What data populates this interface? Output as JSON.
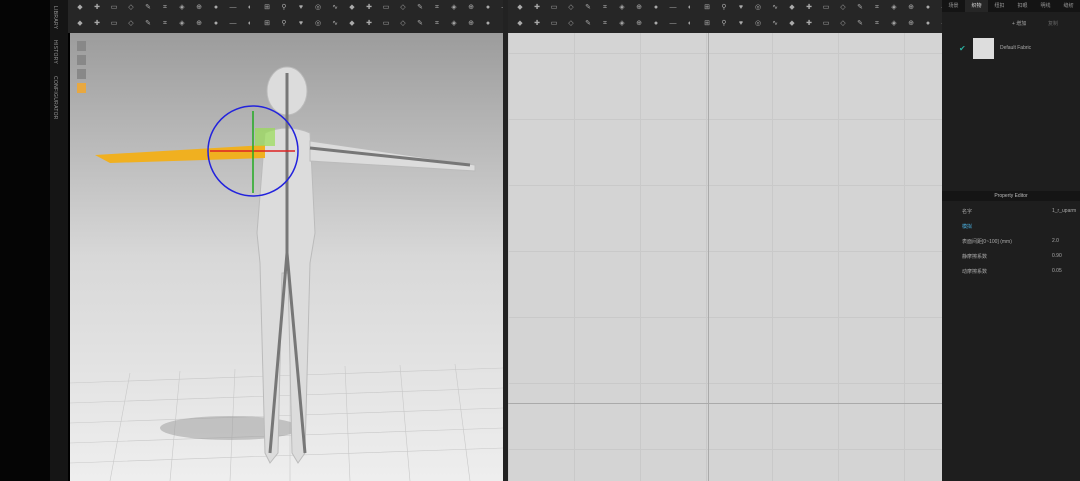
{
  "sidebar": {
    "tabs": [
      "LIBRARY",
      "HISTORY",
      "CONFIGURATOR"
    ]
  },
  "right_panel": {
    "tabs": [
      "场景",
      "织物",
      "纽扣",
      "扣眼",
      "明线",
      "缝纫"
    ],
    "active_tab": 1,
    "add_label": "+ 增加",
    "copy_label": "复制",
    "fabric": {
      "name": "Default Fabric",
      "checked": true
    },
    "property_editor": {
      "title": "Property Editor",
      "rows": [
        {
          "label": "名字",
          "value": "1_r_uparm"
        },
        {
          "label": "模拟",
          "value": "",
          "section": true
        },
        {
          "label": "表面间距[0~100] (mm)",
          "value": "2.0"
        },
        {
          "label": "静摩擦系数",
          "value": "0.90"
        },
        {
          "label": "动摩擦系数",
          "value": "0.05"
        }
      ]
    }
  },
  "colors": {
    "gizmo": "#2222dd",
    "selected_arm": "#f0b020",
    "accent": "#2ab0a0"
  }
}
